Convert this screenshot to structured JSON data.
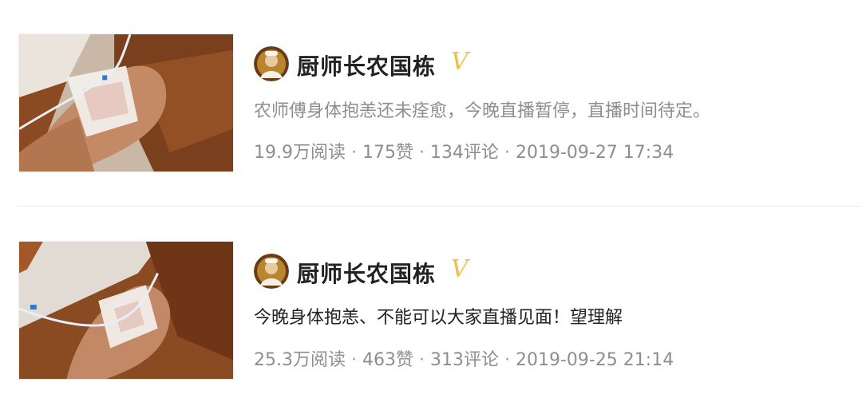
{
  "posts": [
    {
      "author": "厨师长农国栋",
      "verified_mark": "V",
      "text": "农师傅身体抱恙还未痊愈，今晚直播暂停，直播时间待定。",
      "reads": "19.9万阅读",
      "likes": "175赞",
      "comments": "134评论",
      "time": "2019-09-27 17:34",
      "separator": " · "
    },
    {
      "author": "厨师长农国栋",
      "verified_mark": "V",
      "text": "今晚身体抱恙、不能可以大家直播见面！望理解",
      "reads": "25.3万阅读",
      "likes": "463赞",
      "comments": "313评论",
      "time": "2019-09-25 21:14",
      "separator": " · "
    }
  ],
  "colors": {
    "author": "#222222",
    "verified": "#f0bf4a",
    "muted_text": "#8e8e8e",
    "body_text": "#222222",
    "divider": "#ececec"
  },
  "icons": {
    "thumbnail": "iv-drip-hand-photo",
    "avatar": "chef-avatar"
  }
}
